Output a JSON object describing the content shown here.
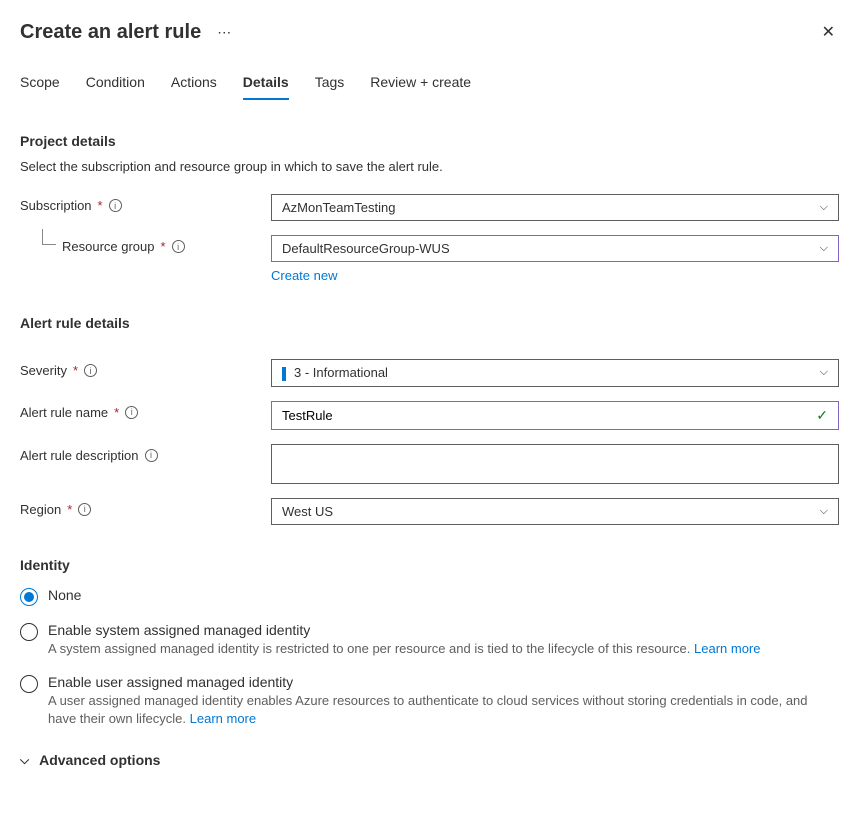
{
  "header": {
    "title": "Create an alert rule"
  },
  "tabs": [
    "Scope",
    "Condition",
    "Actions",
    "Details",
    "Tags",
    "Review + create"
  ],
  "active_tab": "Details",
  "project": {
    "title": "Project details",
    "desc": "Select the subscription and resource group in which to save the alert rule.",
    "subscription": {
      "label": "Subscription",
      "value": "AzMonTeamTesting"
    },
    "resource_group": {
      "label": "Resource group",
      "value": "DefaultResourceGroup-WUS",
      "create_new": "Create new"
    }
  },
  "rule": {
    "title": "Alert rule details",
    "severity": {
      "label": "Severity",
      "value": "3 - Informational"
    },
    "name": {
      "label": "Alert rule name",
      "value": "TestRule"
    },
    "description": {
      "label": "Alert rule description",
      "value": ""
    },
    "region": {
      "label": "Region",
      "value": "West US"
    }
  },
  "identity": {
    "title": "Identity",
    "options": {
      "none": {
        "label": "None"
      },
      "system": {
        "label": "Enable system assigned managed identity",
        "desc": "A system assigned managed identity is restricted to one per resource and is tied to the lifecycle of this resource.",
        "learn_more": "Learn more"
      },
      "user": {
        "label": "Enable user assigned managed identity",
        "desc": "A user assigned managed identity enables Azure resources to authenticate to cloud services without storing credentials in code, and have their own lifecycle.",
        "learn_more": "Learn more"
      }
    },
    "selected": "none"
  },
  "advanced": {
    "label": "Advanced options"
  }
}
